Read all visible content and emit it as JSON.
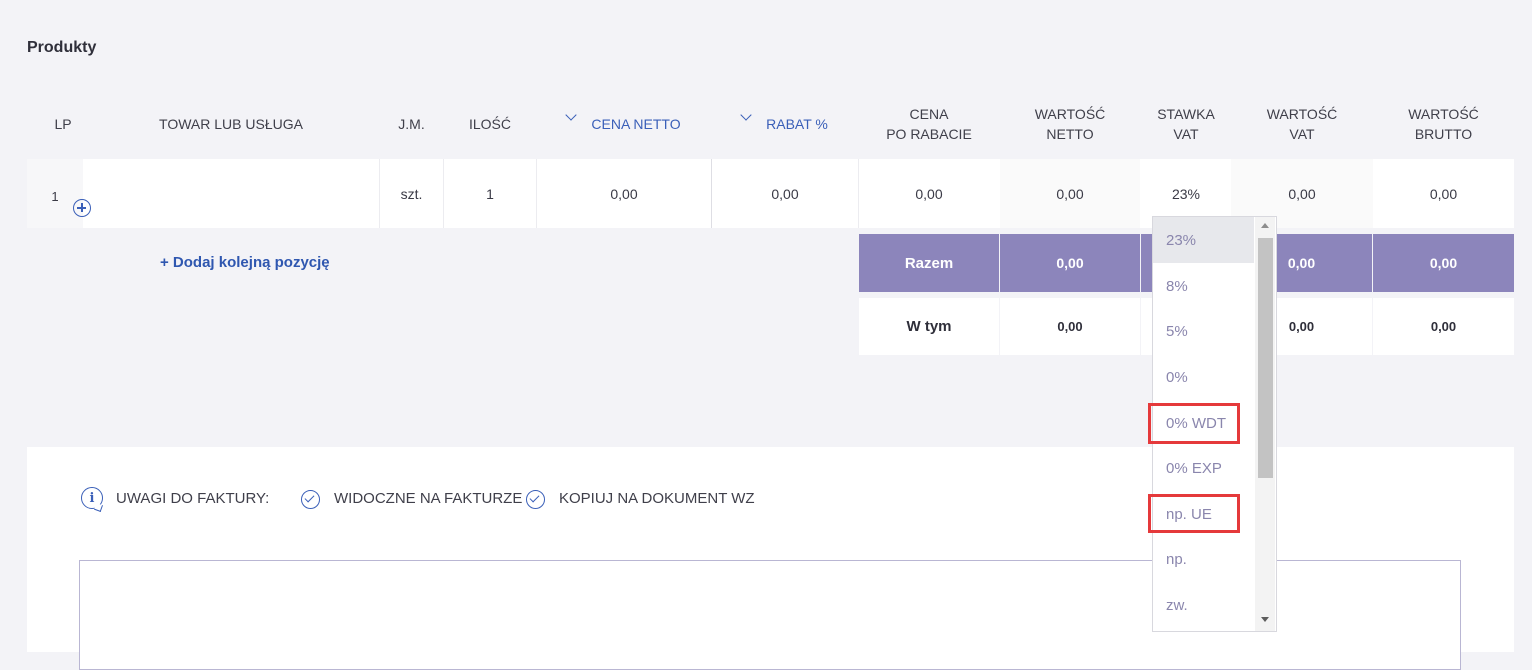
{
  "section_title": "Produkty",
  "columns": {
    "lp": "LP",
    "item": "TOWAR LUB USŁUGA",
    "unit": "J.M.",
    "qty": "ILOŚĆ",
    "net_price": "CENA NETTO",
    "discount": "RABAT %",
    "price_after_line1": "CENA",
    "price_after_line2": "PO RABACIE",
    "net_value_line1": "WARTOŚĆ",
    "net_value_line2": "NETTO",
    "vat_rate_line1": "STAWKA",
    "vat_rate_line2": "VAT",
    "vat_value_line1": "WARTOŚĆ",
    "vat_value_line2": "VAT",
    "gross_value_line1": "WARTOŚĆ",
    "gross_value_line2": "BRUTTO"
  },
  "row": {
    "lp": "1",
    "item": "",
    "unit": "szt.",
    "qty": "1",
    "net_price": "0,00",
    "discount": "0,00",
    "price_after": "0,00",
    "net_value": "0,00",
    "vat_rate": "23%",
    "vat_value": "0,00",
    "gross_value": "0,00"
  },
  "add_position": "+ Dodaj kolejną pozycję",
  "totals": {
    "label": "Razem",
    "net": "0,00",
    "vat": "0,00",
    "gross": "0,00"
  },
  "of_which": {
    "label": "W tym",
    "net": "0,00",
    "vat": "0,00",
    "gross": "0,00"
  },
  "notes": {
    "label": "UWAGI DO FAKTURY:",
    "visible_on_invoice": "WIDOCZNE NA FAKTURZE",
    "copy_to_wz": "KOPIUJ NA DOKUMENT WZ"
  },
  "vat_dropdown": {
    "options": [
      "23%",
      "8%",
      "5%",
      "0%",
      "0% WDT",
      "0% EXP",
      "np. UE",
      "np.",
      "zw."
    ],
    "selected": "23%",
    "highlighted": [
      "0% WDT",
      "np. UE"
    ]
  },
  "colors": {
    "accent": "#3a5fb8",
    "totals_bg": "#8c85bb",
    "highlight_box": "#e5393b"
  }
}
